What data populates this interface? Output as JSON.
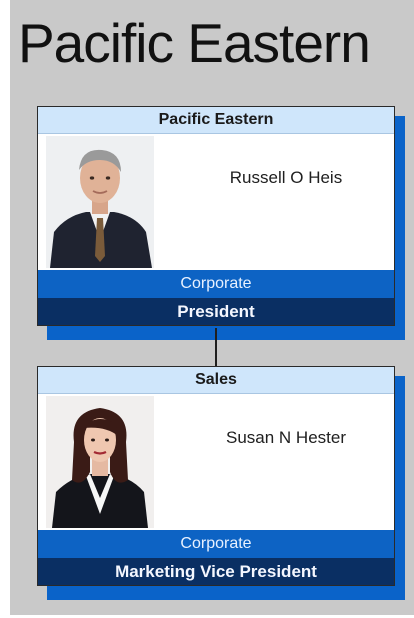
{
  "chart_title": "Pacific Eastern",
  "nodes": [
    {
      "header": "Pacific Eastern",
      "name": "Russell O Heis",
      "department": "Corporate",
      "role": "President",
      "photo": "man-in-suit-photo"
    },
    {
      "header": "Sales",
      "name": "Susan N Hester",
      "department": "Corporate",
      "role": "Marketing Vice President",
      "photo": "woman-in-blazer-photo"
    }
  ],
  "colors": {
    "canvas": "#c9c9c9",
    "header": "#cfe6fb",
    "department": "#0d63c4",
    "role": "#0a2f63",
    "shadow": "#0a63c9"
  }
}
